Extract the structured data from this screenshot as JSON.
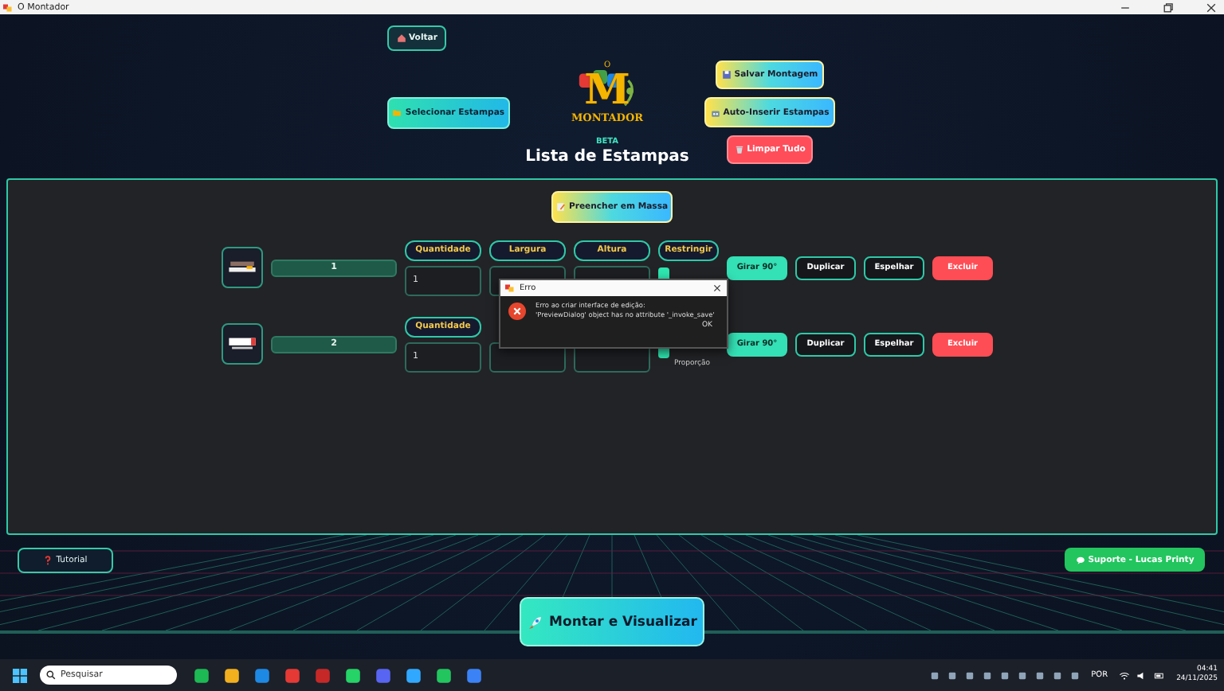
{
  "window": {
    "title": "O Montador"
  },
  "header": {
    "back_button": "Voltar",
    "select_button": "Selecionar Estampas",
    "logo": {
      "small": "O",
      "letter": "M",
      "name": "MONTADOR"
    },
    "badge": "BETA",
    "title": "Lista de Estampas",
    "save_button": "Salvar Montagem",
    "auto_button": "Auto-Inserir Estampas",
    "clear_button": "Limpar Tudo"
  },
  "panel": {
    "fill_button": "Preencher em Massa",
    "rows": [
      {
        "name": "1",
        "thumb": {
          "kind": "dark"
        },
        "fields": [
          {
            "label": "Quantidade",
            "value": "1"
          },
          {
            "label": "Largura"
          },
          {
            "label": "Altura"
          }
        ],
        "restrict_label": "Restringir",
        "checked": true,
        "buttons": [
          "Girar 90°",
          "Duplicar",
          "Espelhar",
          "Excluir"
        ]
      },
      {
        "name": "2",
        "thumb": {
          "kind": "fox"
        },
        "fields": [
          {
            "label": "Quantidade",
            "value": "1"
          }
        ],
        "checked": true,
        "check_label": "Proporção",
        "buttons": [
          "Girar 90°",
          "Duplicar",
          "Espelhar",
          "Excluir"
        ]
      }
    ]
  },
  "dialog": {
    "title": "Erro",
    "message": "Erro ao criar interface de edição:\n'PreviewDialog' object has no attribute '_invoke_save'",
    "ok": "OK"
  },
  "footer": {
    "tutorial_button": "Tutorial",
    "support_button": "Suporte - Lucas Printy",
    "main_button": "Montar e Visualizar"
  },
  "taskbar": {
    "search_placeholder": "Pesquisar",
    "language": "POR",
    "time": "04:41",
    "date": "24/11/2025"
  }
}
